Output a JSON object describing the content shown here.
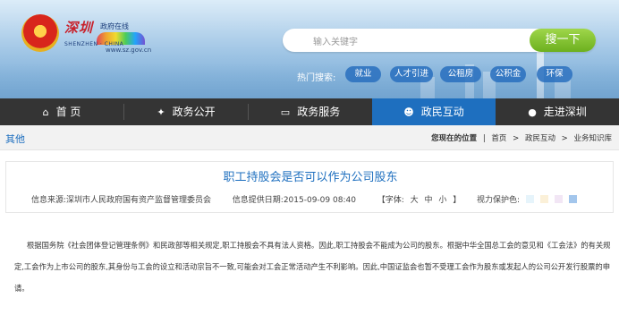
{
  "header": {
    "logo_cn": "深圳",
    "logo_cn2": "政府在线",
    "logo_en": "SHENZHEN · CHINA",
    "url": "www.sz.gov.cn",
    "search_placeholder": "输入关键字",
    "search_button": "搜一下",
    "hot_label": "热门搜索:",
    "hot_items": [
      "就业",
      "人才引进",
      "公租房",
      "公积金",
      "环保"
    ]
  },
  "nav": {
    "items": [
      {
        "label": "首 页",
        "icon": "home-icon"
      },
      {
        "label": "政务公开",
        "icon": "ribbon-icon"
      },
      {
        "label": "政务服务",
        "icon": "monitor-icon"
      },
      {
        "label": "政民互动",
        "icon": "users-icon"
      },
      {
        "label": "走进深圳",
        "icon": "info-icon"
      }
    ],
    "active_index": 3
  },
  "breadcrumb": {
    "left": "其他",
    "position_label": "您现在的位置",
    "items": [
      "首页",
      "政民互动",
      "业务知识库"
    ],
    "sep": ">"
  },
  "article": {
    "title": "职工持股会是否可以作为公司股东",
    "source": "信息来源:深圳市人民政府国有资产监督管理委员会",
    "date": "信息提供日期:2015-09-09 08:40",
    "font_label": "【字体:",
    "font_large": "大",
    "font_medium": "中",
    "font_small": "小",
    "font_close": "】",
    "eye_label": "视力保护色:",
    "eye_colors": [
      "#e6f4fb",
      "#fbf0d8",
      "#f2e6f5",
      "#a3c6ec"
    ],
    "body": "根据国务院《社会团体登记管理条例》和民政部等相关规定,职工持股会不具有法人资格。因此,职工持股会不能成为公司的股东。根据中华全国总工会的意见和《工会法》的有关规定,工会作为上市公司的股东,其身份与工会的设立和活动宗旨不一致,可能会对工会正常活动产生不利影响。因此,中国证监会也暂不受理工会作为股东或发起人的公司公开发行股票的申请。"
  }
}
